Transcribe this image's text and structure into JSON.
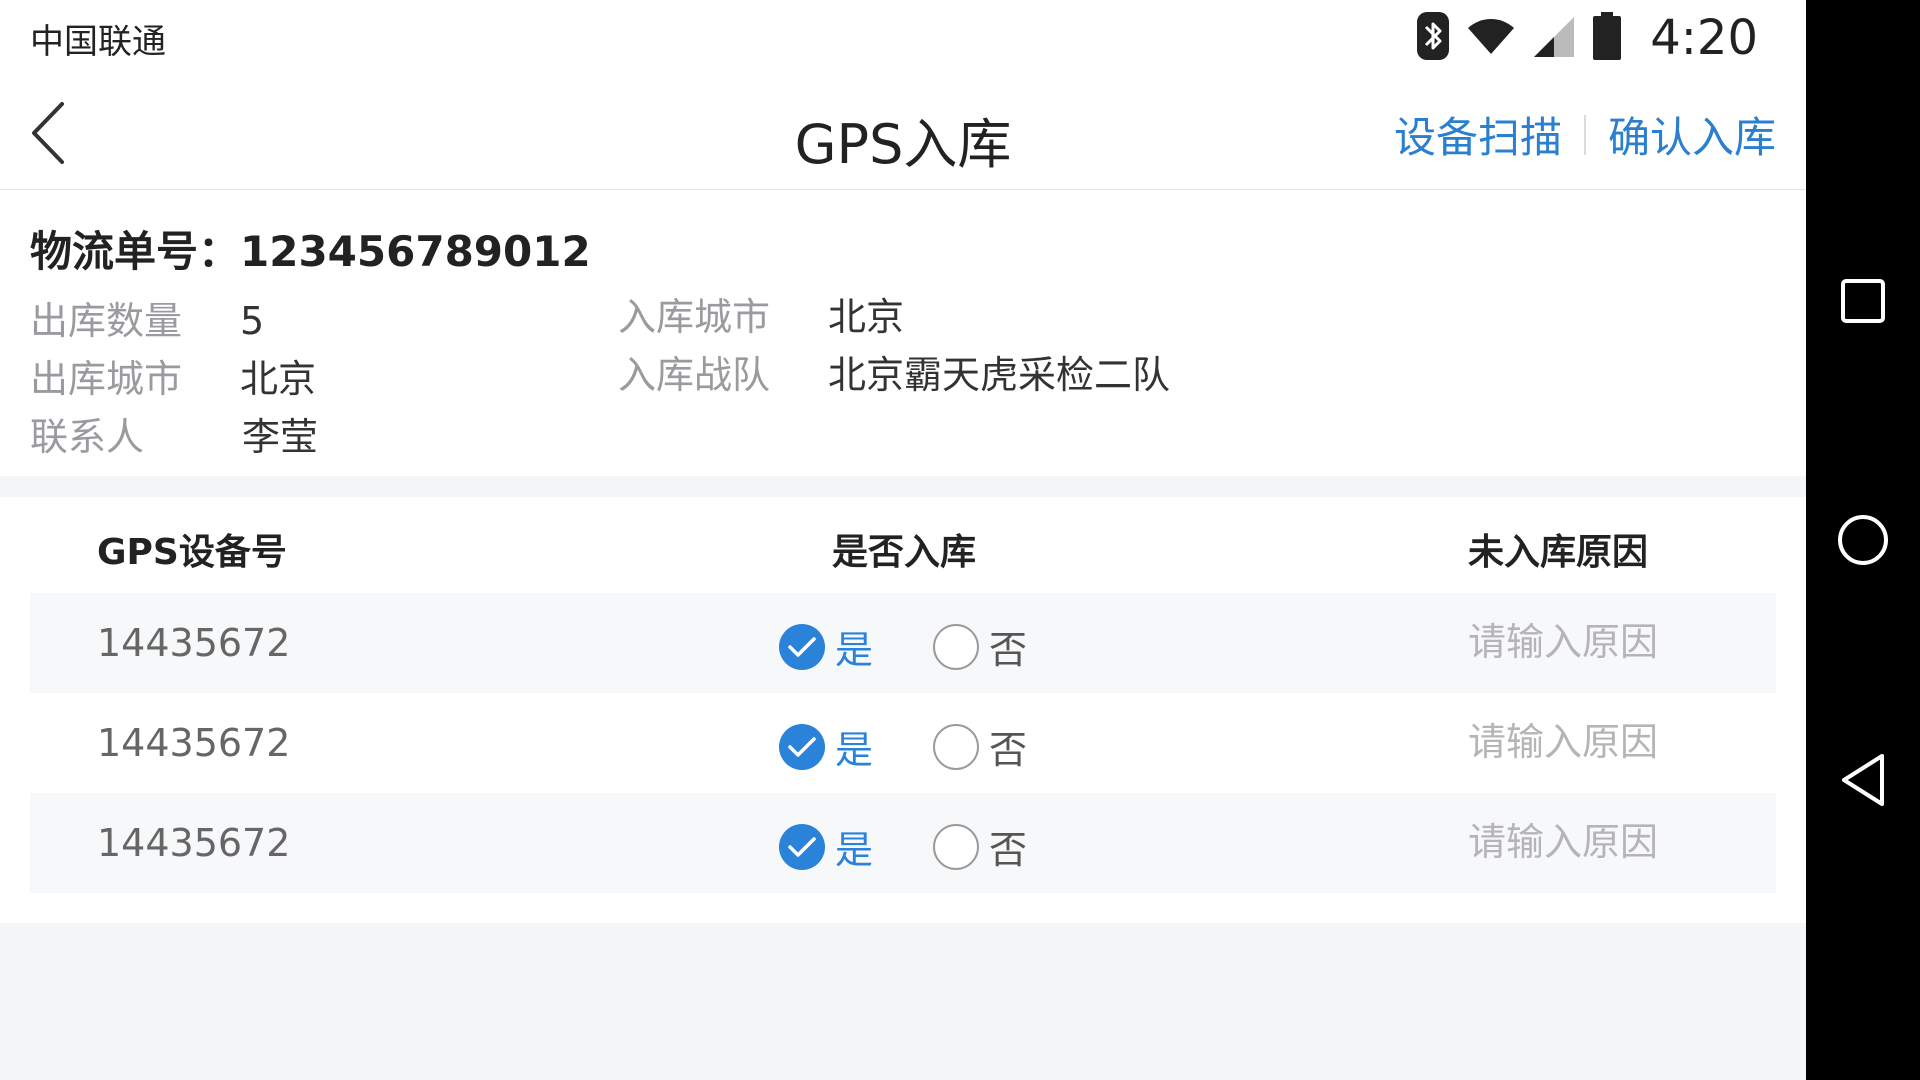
{
  "status_bar": {
    "carrier": "中国联通",
    "time": "4:20",
    "icons": [
      "bluetooth-icon",
      "wifi-icon",
      "signal-icon",
      "battery-icon"
    ]
  },
  "header": {
    "title": "GPS入库",
    "back_icon": "back-arrow-icon",
    "actions": [
      "设备扫描",
      "确认入库"
    ],
    "accent_color": "#2a7fcf"
  },
  "info": {
    "order_label": "物流单号：",
    "order_number": "123456789012",
    "left": [
      {
        "label": "出库数量",
        "value": "5"
      },
      {
        "label": "出库城市",
        "value": "北京"
      },
      {
        "label": "联系人",
        "value": "李莹"
      }
    ],
    "right": [
      {
        "label": "入库城市",
        "value": "北京"
      },
      {
        "label": "入库战队",
        "value": "北京霸天虎采检二队"
      }
    ]
  },
  "table": {
    "headers": [
      "GPS设备号",
      "是否入库",
      "未入库原因"
    ],
    "rows": [
      {
        "device_id": "14435672",
        "yes_label": "是",
        "no_label": "否",
        "in_stock": true,
        "reason_placeholder": "请输入原因"
      },
      {
        "device_id": "14435672",
        "yes_label": "是",
        "no_label": "否",
        "in_stock": true,
        "reason_placeholder": "请输入原因"
      },
      {
        "device_id": "14435672",
        "yes_label": "是",
        "no_label": "否",
        "in_stock": true,
        "reason_placeholder": "请输入原因"
      }
    ]
  },
  "system_nav": [
    "recent-apps-icon",
    "home-icon",
    "back-icon"
  ]
}
